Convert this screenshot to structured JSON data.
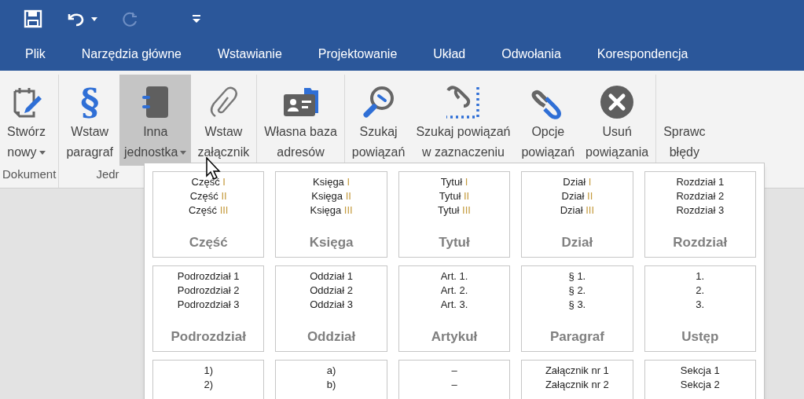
{
  "quick_access": [
    {
      "kind": "save",
      "disabled": false
    },
    {
      "kind": "undo",
      "disabled": false
    },
    {
      "kind": "redo",
      "disabled": true
    },
    {
      "kind": "customize",
      "disabled": false
    }
  ],
  "tabs": [
    {
      "label": "Plik",
      "selected": false
    },
    {
      "label": "Narzędzia główne",
      "selected": false
    },
    {
      "label": "Wstawianie",
      "selected": false
    },
    {
      "label": "Projektowanie",
      "selected": false
    },
    {
      "label": "Układ",
      "selected": false
    },
    {
      "label": "Odwołania",
      "selected": false
    },
    {
      "label": "Korespondencja",
      "selected": false
    }
  ],
  "ribbon_groups": [
    {
      "label": "Dokument",
      "buttons": [
        {
          "kind": "clipboard",
          "lines": [
            "Stwórz",
            "nowy"
          ],
          "dropdown": true,
          "pressed": false
        }
      ]
    },
    {
      "label": "Jedr",
      "buttons": [
        {
          "kind": "glyph",
          "glyph": "§",
          "lines": [
            "Wstaw",
            "paragraf"
          ],
          "dropdown": false,
          "pressed": false
        },
        {
          "kind": "notebook",
          "lines": [
            "Inna",
            "jednostka"
          ],
          "dropdown": true,
          "pressed": true
        },
        {
          "kind": "paperclip",
          "lines": [
            "Wstaw",
            "załącznik"
          ],
          "dropdown": false,
          "pressed": false
        }
      ]
    },
    {
      "buttons": [
        {
          "kind": "card",
          "lines": [
            "Własna baza",
            "adresów"
          ],
          "dropdown": false,
          "pressed": false
        }
      ]
    },
    {
      "buttons": [
        {
          "kind": "search",
          "lines": [
            "Szukaj",
            "powiązań"
          ],
          "dropdown": false,
          "pressed": false
        },
        {
          "kind": "selection",
          "lines": [
            "Szukaj powiązań",
            "w zaznaczeniu"
          ],
          "dropdown": false,
          "pressed": false
        },
        {
          "kind": "link",
          "lines": [
            "Opcje",
            "powiązań"
          ],
          "dropdown": false,
          "pressed": false
        },
        {
          "kind": "remove",
          "lines": [
            "Usuń",
            "powiązania"
          ],
          "dropdown": false,
          "pressed": false
        }
      ]
    },
    {
      "buttons": [
        {
          "kind": "plain",
          "lines": [
            "Sprawc",
            "błędy"
          ],
          "dropdown": false,
          "pressed": false
        }
      ]
    }
  ],
  "gallery": [
    {
      "label": "Część",
      "lines": [
        {
          "text": "Część",
          "numeral": "I"
        },
        {
          "text": "Część",
          "numeral": "II"
        },
        {
          "text": "Część",
          "numeral": "III"
        }
      ]
    },
    {
      "label": "Księga",
      "lines": [
        {
          "text": "Księga",
          "numeral": "I"
        },
        {
          "text": "Księga",
          "numeral": "II"
        },
        {
          "text": "Księga",
          "numeral": "III"
        }
      ]
    },
    {
      "label": "Tytuł",
      "lines": [
        {
          "text": "Tytuł",
          "numeral": "I"
        },
        {
          "text": "Tytuł",
          "numeral": "II"
        },
        {
          "text": "Tytuł",
          "numeral": "III"
        }
      ]
    },
    {
      "label": "Dział",
      "lines": [
        {
          "text": "Dział",
          "numeral": "I"
        },
        {
          "text": "Dział",
          "numeral": "II"
        },
        {
          "text": "Dział",
          "numeral": "III"
        }
      ]
    },
    {
      "label": "Rozdział",
      "lines": [
        {
          "text": "Rozdział 1"
        },
        {
          "text": "Rozdział 2"
        },
        {
          "text": "Rozdział 3"
        }
      ]
    },
    {
      "label": "Podrozdział",
      "lines": [
        {
          "text": "Podrozdział 1"
        },
        {
          "text": "Podrozdział 2"
        },
        {
          "text": "Podrozdział 3"
        }
      ]
    },
    {
      "label": "Oddział",
      "lines": [
        {
          "text": "Oddział 1"
        },
        {
          "text": "Oddział 2"
        },
        {
          "text": "Oddział 3"
        }
      ]
    },
    {
      "label": "Artykuł",
      "lines": [
        {
          "text": "Art. 1."
        },
        {
          "text": "Art. 2."
        },
        {
          "text": "Art. 3."
        }
      ]
    },
    {
      "label": "Paragraf",
      "lines": [
        {
          "text": "§ 1."
        },
        {
          "text": "§ 2."
        },
        {
          "text": "§ 3."
        }
      ]
    },
    {
      "label": "Ustęp",
      "lines": [
        {
          "text": "1."
        },
        {
          "text": "2."
        },
        {
          "text": "3."
        }
      ]
    },
    {
      "lines": [
        {
          "text": "1)"
        },
        {
          "text": "2)"
        }
      ]
    },
    {
      "lines": [
        {
          "text": "a)"
        },
        {
          "text": "b)"
        }
      ]
    },
    {
      "lines": [
        {
          "text": "–"
        },
        {
          "text": "–"
        }
      ]
    },
    {
      "lines": [
        {
          "text": "Załącznik nr 1"
        },
        {
          "text": "Załącznik nr 2"
        }
      ]
    },
    {
      "lines": [
        {
          "text": "Sekcja 1"
        },
        {
          "text": "Sekcja 2"
        }
      ]
    }
  ]
}
